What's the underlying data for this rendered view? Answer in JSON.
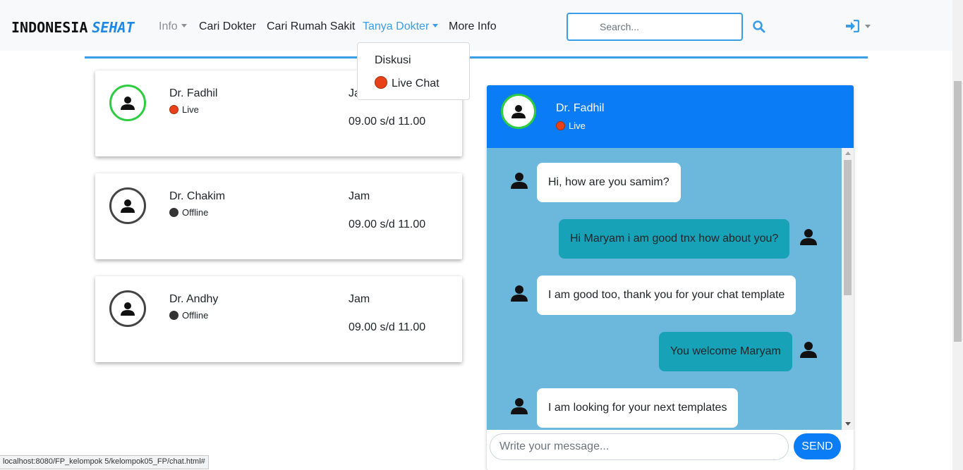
{
  "navbar": {
    "brand_part1": "INDONESIA",
    "brand_part2": "SEHAT",
    "links": {
      "info": "Info",
      "cari_dokter": "Cari Dokter",
      "cari_rumah_sakit": "Cari Rumah Sakit",
      "tanya_dokter": "Tanya Dokter",
      "more_info": "More Info"
    },
    "search_placeholder": "Search...",
    "accent_color": "#3a9ee6"
  },
  "dropdown": {
    "items": [
      "Diskusi",
      "Live Chat"
    ]
  },
  "doctors": [
    {
      "name": "Dr. Fadhil",
      "status": "Live",
      "jam_label": "Jam",
      "hours": "09.00 s/d 11.00"
    },
    {
      "name": "Dr. Chakim",
      "status": "Offline",
      "jam_label": "Jam",
      "hours": "09.00 s/d 11.00"
    },
    {
      "name": "Dr. Andhy",
      "status": "Offline",
      "jam_label": "Jam",
      "hours": "09.00 s/d 11.00"
    }
  ],
  "chat": {
    "doctor_name": "Dr. Fadhil",
    "doctor_status": "Live",
    "header_color": "#0a7cf5",
    "messages": [
      {
        "from": "in",
        "text": "Hi, how are you samim?"
      },
      {
        "from": "out",
        "text": "Hi Maryam i am good tnx how about you?"
      },
      {
        "from": "in",
        "text": "I am good too, thank you for your chat template"
      },
      {
        "from": "out",
        "text": "You welcome Maryam"
      },
      {
        "from": "in",
        "text": "I am looking for your next templates"
      }
    ],
    "input_placeholder": "Write your message...",
    "send_label": "SEND"
  },
  "status_bar_url": "localhost:8080/FP_kelompok 5/kelompok05_FP/chat.html#"
}
